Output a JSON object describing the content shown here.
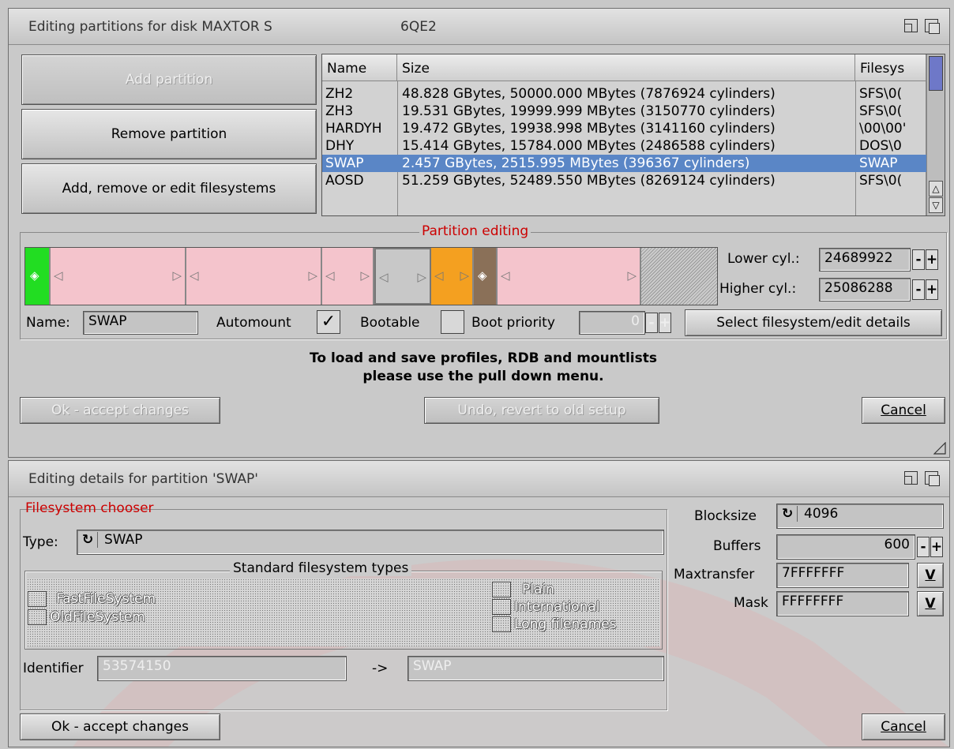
{
  "win1": {
    "title": "Editing partitions for disk MAXTOR S",
    "title_suffix": "6QE2",
    "buttons": {
      "add_partition": "Add partition",
      "remove_partition": "Remove partition",
      "filesystems": "Add, remove or edit filesystems"
    },
    "table": {
      "headers": [
        "Name",
        "Size",
        "Filesys"
      ],
      "rows": [
        {
          "name": "ZH2",
          "size": "48.828 GBytes, 50000.000 MBytes (7876924 cylinders)",
          "fs": "SFS\\0("
        },
        {
          "name": "ZH3",
          "size": "19.531 GBytes, 19999.999 MBytes (3150770 cylinders)",
          "fs": "SFS\\0("
        },
        {
          "name": "HARDYH",
          "size": "19.472 GBytes, 19938.998 MBytes (3141160 cylinders)",
          "fs": "\\00\\00'"
        },
        {
          "name": "DHY",
          "size": "15.414 GBytes, 15784.000 MBytes (2486588 cylinders)",
          "fs": "DOS\\0"
        },
        {
          "name": "SWAP",
          "size": "2.457 GBytes, 2515.995 MBytes (396367 cylinders)",
          "fs": "SWAP"
        },
        {
          "name": "AOSD",
          "size": "51.259 GBytes, 52489.550 MBytes (8269124 cylinders)",
          "fs": "SFS\\0("
        }
      ],
      "selected_index": 4
    },
    "partition_editing": {
      "title": "Partition editing",
      "lower_cyl_label": "Lower cyl.:",
      "lower_cyl_value": "24689922",
      "higher_cyl_label": "Higher cyl.:",
      "higher_cyl_value": "25086288",
      "name_label": "Name:",
      "name_value": "SWAP",
      "automount_label": "Automount",
      "automount_checked": true,
      "bootable_label": "Bootable",
      "bootable_checked": false,
      "boot_priority_label": "Boot priority",
      "boot_priority_value": "0",
      "select_fs_button": "Select filesystem/edit details"
    },
    "info_line1": "To load and save profiles, RDB and mountlists",
    "info_line2": "please use the pull down menu.",
    "ok_button": "Ok - accept changes",
    "undo_button": "Undo, revert to old setup",
    "cancel_button": "Cancel"
  },
  "win2": {
    "title": "Editing details for partition 'SWAP'",
    "fs_chooser_title": "Filesystem chooser",
    "type_label": "Type:",
    "type_value": "SWAP",
    "std_types_title": "Standard filesystem types",
    "fast_fs": "FastFileSystem",
    "old_fs": "OldFileSystem",
    "plain": "Plain",
    "international": "International",
    "long_filenames": "Long filenames",
    "identifier_label": "Identifier",
    "identifier_value": "53574150",
    "arrow": "->",
    "identifier_text": "SWAP",
    "blocksize_label": "Blocksize",
    "blocksize_value": "4096",
    "buffers_label": "Buffers",
    "buffers_value": "600",
    "maxtransfer_label": "Maxtransfer",
    "maxtransfer_value": "7FFFFFFF",
    "mask_label": "Mask",
    "mask_value": "FFFFFFFF",
    "v_button": "V",
    "ok_button": "Ok - accept changes",
    "cancel_button": "Cancel"
  },
  "colors": {
    "selection": "#5a86c6",
    "partition_pink": "#f4c4cc",
    "partition_green": "#22dd22",
    "partition_orange": "#f4a020",
    "partition_brown": "#8a7058",
    "group_title": "#cc0000"
  }
}
